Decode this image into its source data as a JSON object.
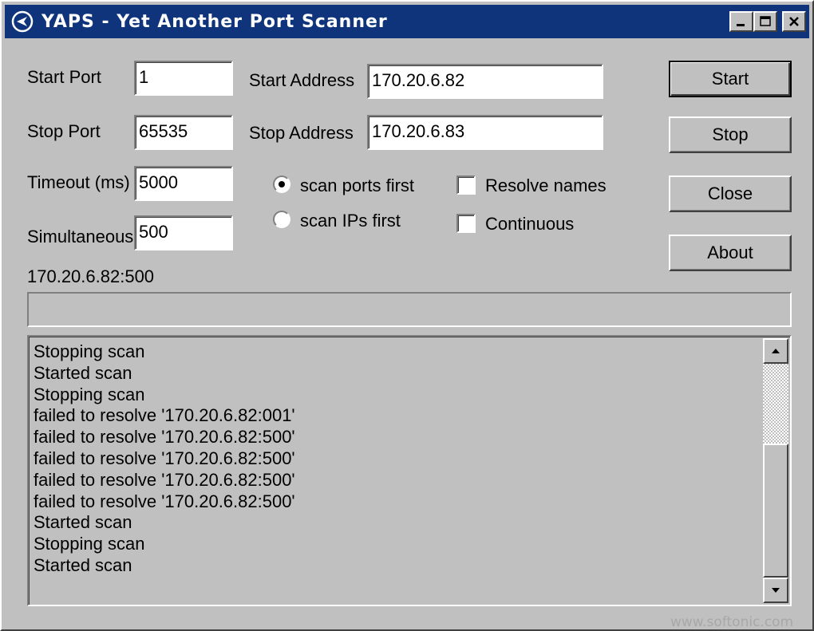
{
  "window": {
    "title": "YAPS - Yet Another Port Scanner"
  },
  "form": {
    "start_port_label": "Start Port",
    "start_port_value": "1",
    "stop_port_label": "Stop Port",
    "stop_port_value": "65535",
    "timeout_label": "Timeout (ms)",
    "timeout_value": "5000",
    "simultaneous_label": "Simultaneous",
    "simultaneous_value": "500",
    "start_address_label": "Start Address",
    "start_address_value": "170.20.6.82",
    "stop_address_label": "Stop Address",
    "stop_address_value": "170.20.6.83"
  },
  "options": {
    "scan_ports_first_label": "scan ports first",
    "scan_ports_first_selected": true,
    "scan_ips_first_label": "scan IPs first",
    "scan_ips_first_selected": false,
    "resolve_names_label": "Resolve names",
    "resolve_names_checked": false,
    "continuous_label": "Continuous",
    "continuous_checked": false
  },
  "buttons": {
    "start": "Start",
    "stop": "Stop",
    "close": "Close",
    "about": "About"
  },
  "status": {
    "current": "170.20.6.82:500",
    "progress_fraction": 0
  },
  "log": [
    "Stopping scan",
    "Started scan",
    "Stopping scan",
    "failed to resolve '170.20.6.82:001'",
    "failed to resolve '170.20.6.82:500'",
    "failed to resolve '170.20.6.82:500'",
    "failed to resolve '170.20.6.82:500'",
    "failed to resolve '170.20.6.82:500'",
    "Started scan",
    "Stopping scan",
    "Started scan"
  ],
  "watermark": "www.softonic.com",
  "colors": {
    "titlebar": "#10347c",
    "face": "#c0c0c0"
  }
}
